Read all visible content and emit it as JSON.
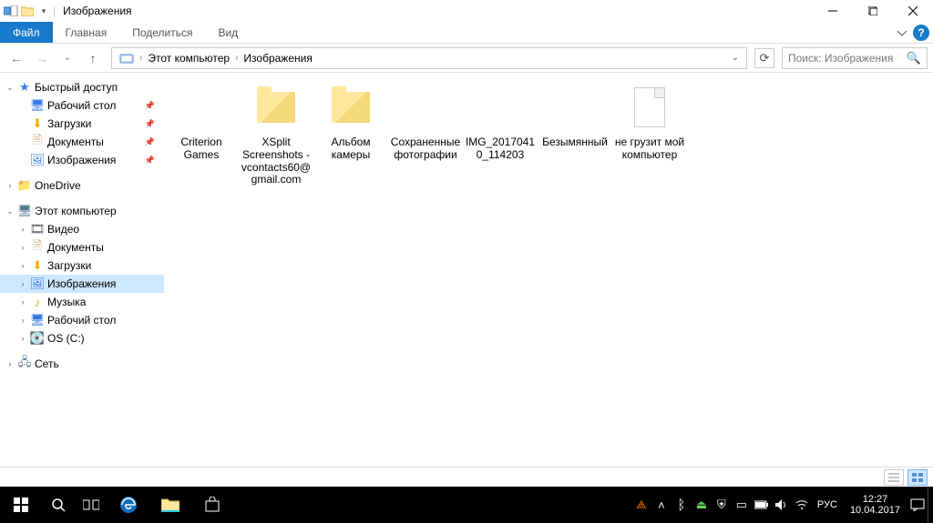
{
  "window": {
    "title": "Изображения"
  },
  "ribbon": {
    "file": "Файл",
    "tabs": [
      "Главная",
      "Поделиться",
      "Вид"
    ]
  },
  "breadcrumb": {
    "items": [
      "Этот компьютер",
      "Изображения"
    ]
  },
  "search": {
    "placeholder": "Поиск: Изображения"
  },
  "sidebar": {
    "quick_access": {
      "label": "Быстрый доступ",
      "items": [
        {
          "label": "Рабочий стол",
          "icon": "desktop",
          "pinned": true
        },
        {
          "label": "Загрузки",
          "icon": "downloads",
          "pinned": true
        },
        {
          "label": "Документы",
          "icon": "docs",
          "pinned": true
        },
        {
          "label": "Изображения",
          "icon": "pictures",
          "pinned": true
        }
      ]
    },
    "onedrive": {
      "label": "OneDrive"
    },
    "this_pc": {
      "label": "Этот компьютер",
      "items": [
        {
          "label": "Видео",
          "icon": "video"
        },
        {
          "label": "Документы",
          "icon": "docs"
        },
        {
          "label": "Загрузки",
          "icon": "downloads"
        },
        {
          "label": "Изображения",
          "icon": "pictures",
          "selected": true
        },
        {
          "label": "Музыка",
          "icon": "music"
        },
        {
          "label": "Рабочий стол",
          "icon": "desktop"
        },
        {
          "label": "OS (C:)",
          "icon": "disk"
        }
      ]
    },
    "network": {
      "label": "Сеть"
    }
  },
  "files": [
    {
      "name": "Criterion Games",
      "type": "folder-empty"
    },
    {
      "name": "XSplit Screenshots - vcontacts60@gmail.com",
      "type": "folder"
    },
    {
      "name": "Альбом камеры",
      "type": "folder"
    },
    {
      "name": "Сохраненные фотографии",
      "type": "folder-empty"
    },
    {
      "name": "IMG_20170410_114203",
      "type": "file-empty"
    },
    {
      "name": "Безымянный",
      "type": "file-empty"
    },
    {
      "name": "не грузит мой компьютер",
      "type": "file"
    }
  ],
  "taskbar": {
    "lang": "РУС",
    "time": "12:27",
    "date": "10.04.2017"
  }
}
